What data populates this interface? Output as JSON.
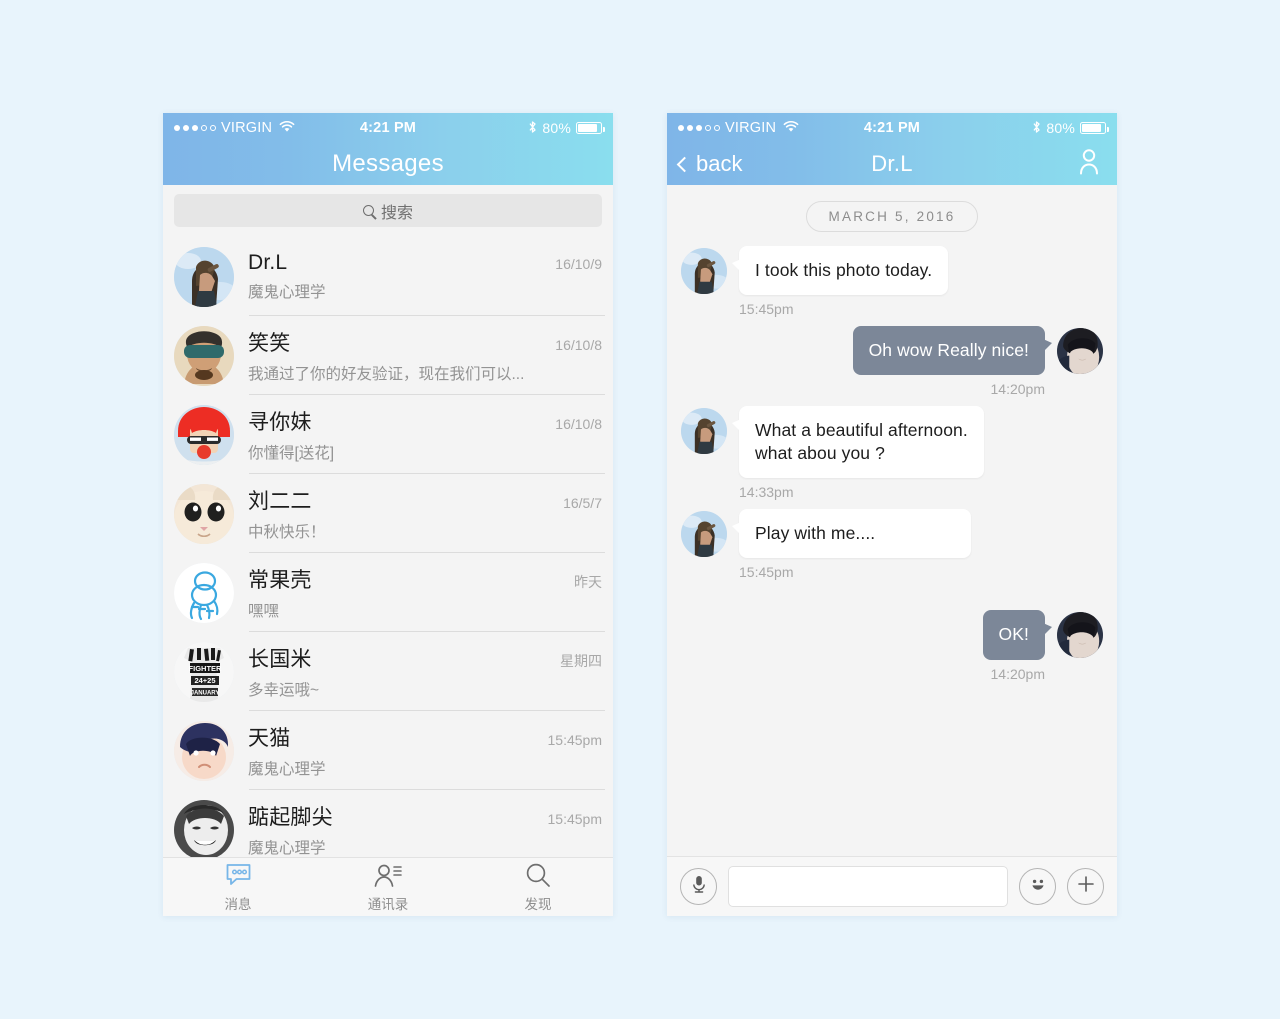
{
  "theme": {
    "page_background": "#E8F4FC",
    "gradient_start": "#7FB5E8",
    "gradient_end": "#8ADEEE",
    "bubble_out_color": "#7C8798",
    "bubble_in_color": "#FFFFFF",
    "screen_background": "#F4F4F4"
  },
  "status_bar": {
    "carrier": "VIRGIN",
    "signal_filled": 3,
    "signal_empty": 2,
    "wifi_icon": "wifi-icon",
    "time": "4:21 PM",
    "bluetooth_icon": "bluetooth-icon",
    "battery_percent": "80%",
    "battery_icon": "battery-icon"
  },
  "messages_screen": {
    "nav": {
      "title": "Messages"
    },
    "search": {
      "placeholder": "搜索",
      "icon": "search-icon"
    },
    "conversations": [
      {
        "name": "Dr.L",
        "snippet": "魔鬼心理学",
        "time": "16/10/9",
        "avatar": "man-sky-avatar"
      },
      {
        "name": "笑笑",
        "snippet": "我通过了你的好友验证，现在我们可以...",
        "time": "16/10/8",
        "avatar": "man-blindfold-avatar"
      },
      {
        "name": "寻你妹",
        "snippet": "你懂得[送花]",
        "time": "16/10/8",
        "avatar": "redhair-cartoon-avatar"
      },
      {
        "name": "刘二二",
        "snippet": "中秋快乐！",
        "time": "16/5/7",
        "avatar": "cat-avatar"
      },
      {
        "name": "常果壳",
        "snippet": "嘿嘿",
        "time": "昨天",
        "avatar": "blue-outline-bear-avatar"
      },
      {
        "name": "长国米",
        "snippet": "多幸运哦~",
        "time": "星期四",
        "avatar": "typography-shirt-avatar"
      },
      {
        "name": "天猫",
        "snippet": "魔鬼心理学",
        "time": "15:45pm",
        "avatar": "cartoon-hero-avatar"
      },
      {
        "name": "踮起脚尖",
        "snippet": "魔鬼心理学",
        "time": "15:45pm",
        "avatar": "mask-face-avatar"
      }
    ],
    "tabs": [
      {
        "label": "消息",
        "icon": "chat-bubble-icon",
        "active": true
      },
      {
        "label": "通讯录",
        "icon": "contacts-icon",
        "active": false
      },
      {
        "label": "发现",
        "icon": "search-icon",
        "active": false
      }
    ]
  },
  "chat_screen": {
    "nav": {
      "back_label": "back",
      "back_icon": "chevron-left-icon",
      "title": "Dr.L",
      "right_icon": "person-icon"
    },
    "date_divider": "MARCH 5, 2016",
    "messages": [
      {
        "side": "in",
        "text": "I took this photo today.",
        "time": "15:45pm",
        "avatar": "man-sky-avatar"
      },
      {
        "side": "out",
        "text": "Oh wow Really nice!",
        "time": "14:20pm",
        "avatar": "dark-hair-man-avatar"
      },
      {
        "side": "in",
        "text": "What a beautiful afternoon.\nwhat abou you ?",
        "time": "14:33pm",
        "avatar": "man-sky-avatar"
      },
      {
        "side": "in",
        "text": "Play with me....",
        "time": "15:45pm",
        "avatar": "man-sky-avatar"
      },
      {
        "side": "out",
        "text": "OK!",
        "time": "14:20pm",
        "avatar": "dark-hair-man-avatar"
      }
    ],
    "input_bar": {
      "voice_icon": "microphone-icon",
      "field_value": "",
      "field_placeholder": "",
      "emoji_icon": "smiley-icon",
      "add_icon": "plus-icon"
    }
  }
}
